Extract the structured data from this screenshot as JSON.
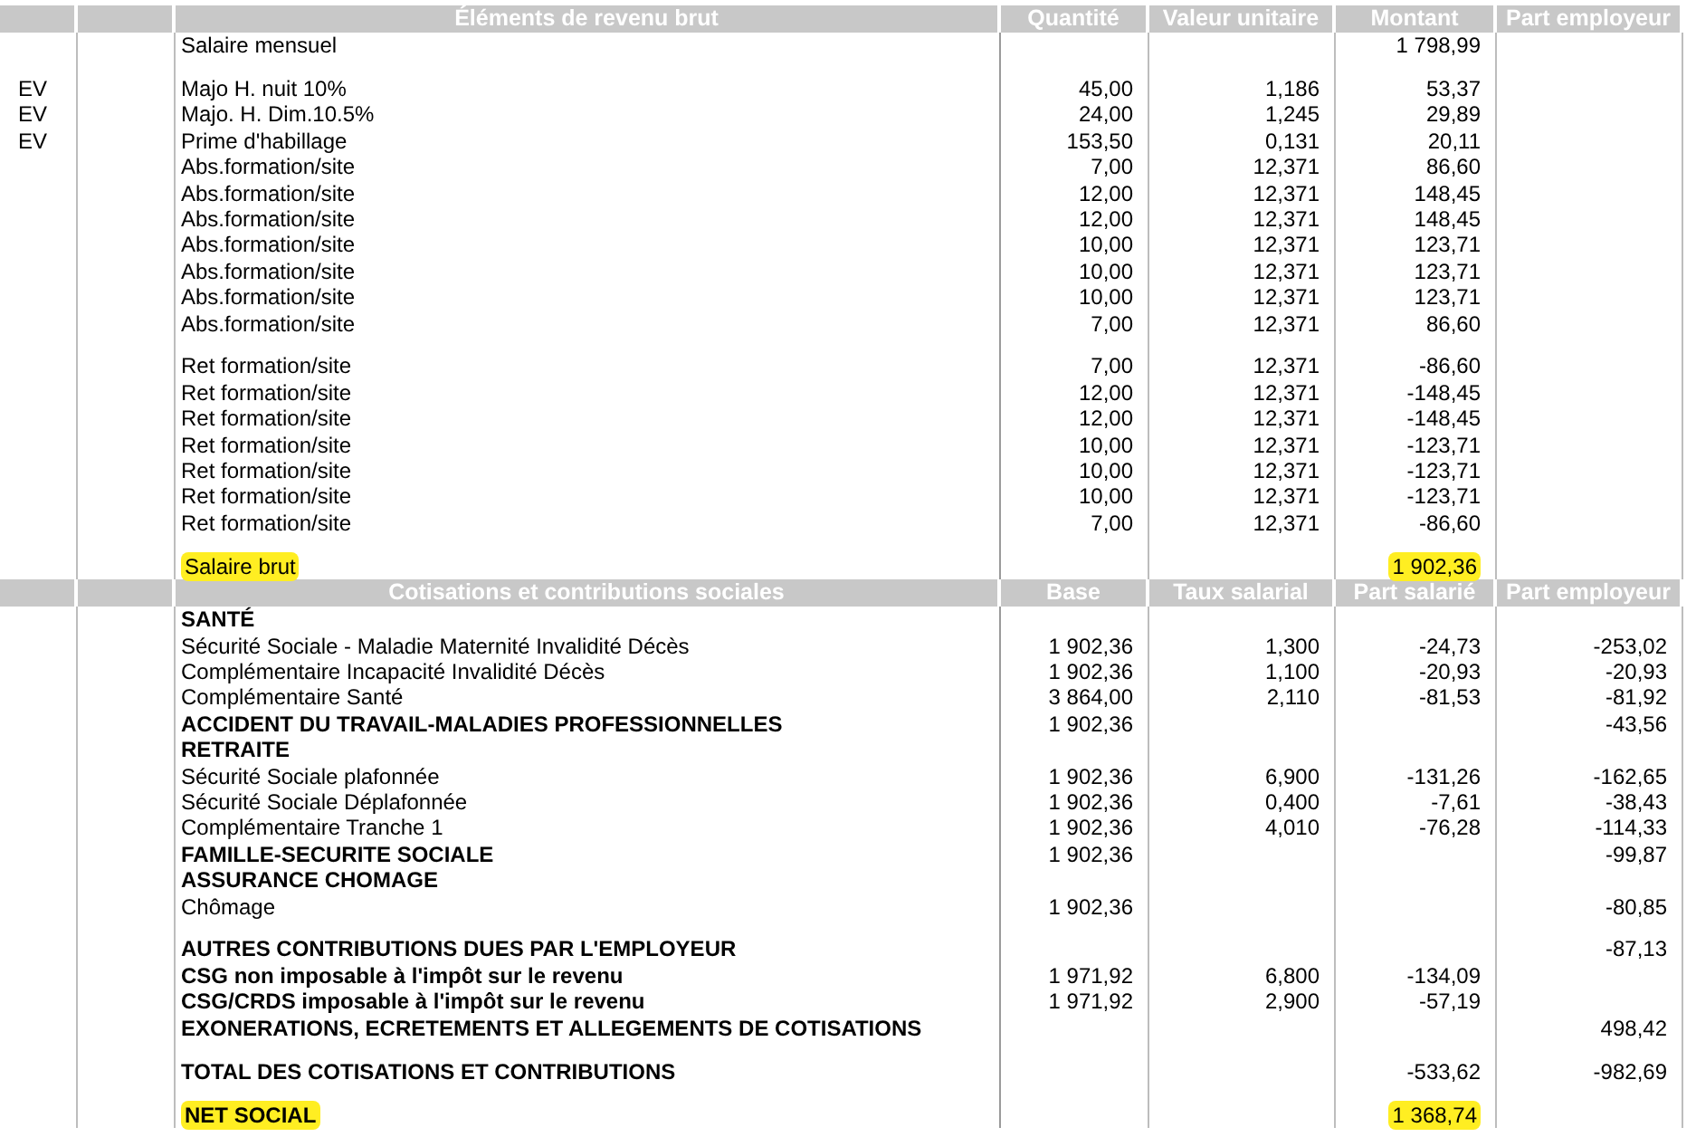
{
  "sections": [
    {
      "title": "Éléments de revenu brut",
      "columns": [
        "Quantité",
        "Valeur unitaire",
        "Montant",
        "Part employeur"
      ],
      "rows": [
        {
          "kind": "line",
          "space_before": false,
          "highlighted": false,
          "label": "Salaire mensuel",
          "amount": "1 798,99"
        },
        {
          "kind": "line",
          "space_before": true,
          "highlighted": false,
          "code": "EV",
          "label": "Majo H. nuit 10%",
          "quantity": "45,00",
          "unit_value": "1,186",
          "amount": "53,37"
        },
        {
          "kind": "line",
          "space_before": false,
          "highlighted": false,
          "code": "EV",
          "label": "Majo. H. Dim.10.5%",
          "quantity": "24,00",
          "unit_value": "1,245",
          "amount": "29,89"
        },
        {
          "kind": "line",
          "space_before": false,
          "highlighted": false,
          "code": "EV",
          "label": "Prime d'habillage",
          "quantity": "153,50",
          "unit_value": "0,131",
          "amount": "20,11"
        },
        {
          "kind": "line",
          "space_before": false,
          "highlighted": false,
          "label": "Abs.formation/site",
          "quantity": "7,00",
          "unit_value": "12,371",
          "amount": "86,60"
        },
        {
          "kind": "line",
          "space_before": false,
          "highlighted": false,
          "label": "Abs.formation/site",
          "quantity": "12,00",
          "unit_value": "12,371",
          "amount": "148,45"
        },
        {
          "kind": "line",
          "space_before": false,
          "highlighted": false,
          "label": "Abs.formation/site",
          "quantity": "12,00",
          "unit_value": "12,371",
          "amount": "148,45"
        },
        {
          "kind": "line",
          "space_before": false,
          "highlighted": false,
          "label": "Abs.formation/site",
          "quantity": "10,00",
          "unit_value": "12,371",
          "amount": "123,71"
        },
        {
          "kind": "line",
          "space_before": false,
          "highlighted": false,
          "label": "Abs.formation/site",
          "quantity": "10,00",
          "unit_value": "12,371",
          "amount": "123,71"
        },
        {
          "kind": "line",
          "space_before": false,
          "highlighted": false,
          "label": "Abs.formation/site",
          "quantity": "10,00",
          "unit_value": "12,371",
          "amount": "123,71"
        },
        {
          "kind": "line",
          "space_before": false,
          "highlighted": false,
          "label": "Abs.formation/site",
          "quantity": "7,00",
          "unit_value": "12,371",
          "amount": "86,60"
        },
        {
          "kind": "line",
          "space_before": true,
          "highlighted": false,
          "label": "Ret formation/site",
          "quantity": "7,00",
          "unit_value": "12,371",
          "amount": "-86,60"
        },
        {
          "kind": "line",
          "space_before": false,
          "highlighted": false,
          "label": "Ret formation/site",
          "quantity": "12,00",
          "unit_value": "12,371",
          "amount": "-148,45"
        },
        {
          "kind": "line",
          "space_before": false,
          "highlighted": false,
          "label": "Ret formation/site",
          "quantity": "12,00",
          "unit_value": "12,371",
          "amount": "-148,45"
        },
        {
          "kind": "line",
          "space_before": false,
          "highlighted": false,
          "label": "Ret formation/site",
          "quantity": "10,00",
          "unit_value": "12,371",
          "amount": "-123,71"
        },
        {
          "kind": "line",
          "space_before": false,
          "highlighted": false,
          "label": "Ret formation/site",
          "quantity": "10,00",
          "unit_value": "12,371",
          "amount": "-123,71"
        },
        {
          "kind": "line",
          "space_before": false,
          "highlighted": false,
          "label": "Ret formation/site",
          "quantity": "10,00",
          "unit_value": "12,371",
          "amount": "-123,71"
        },
        {
          "kind": "line",
          "space_before": false,
          "highlighted": false,
          "label": "Ret formation/site",
          "quantity": "7,00",
          "unit_value": "12,371",
          "amount": "-86,60"
        },
        {
          "kind": "line",
          "space_before": true,
          "highlighted": true,
          "label": "Salaire brut",
          "amount": "1 902,36"
        }
      ]
    },
    {
      "title": "Cotisations et contributions sociales",
      "columns": [
        "Base",
        "Taux salarial",
        "Part salarié",
        "Part employeur"
      ],
      "rows": [
        {
          "kind": "heading",
          "space_before": false,
          "highlighted": false,
          "label": "SANTÉ"
        },
        {
          "kind": "line",
          "space_before": false,
          "highlighted": false,
          "label": "Sécurité Sociale - Maladie Maternité Invalidité Décès",
          "base": "1 902,36",
          "employee_rate": "1,300",
          "employee_part": "-24,73",
          "employer_part": "-253,02"
        },
        {
          "kind": "line",
          "space_before": false,
          "highlighted": false,
          "label": "Complémentaire Incapacité Invalidité Décès",
          "base": "1 902,36",
          "employee_rate": "1,100",
          "employee_part": "-20,93",
          "employer_part": "-20,93"
        },
        {
          "kind": "line",
          "space_before": false,
          "highlighted": false,
          "label": "Complémentaire Santé",
          "base": "3 864,00",
          "employee_rate": "2,110",
          "employee_part": "-81,53",
          "employer_part": "-81,92"
        },
        {
          "kind": "heading",
          "space_before": false,
          "highlighted": false,
          "label": "ACCIDENT DU TRAVAIL-MALADIES PROFESSIONNELLES",
          "base": "1 902,36",
          "employer_part": "-43,56"
        },
        {
          "kind": "heading",
          "space_before": false,
          "highlighted": false,
          "label": "RETRAITE"
        },
        {
          "kind": "line",
          "space_before": false,
          "highlighted": false,
          "label": "Sécurité Sociale plafonnée",
          "base": "1 902,36",
          "employee_rate": "6,900",
          "employee_part": "-131,26",
          "employer_part": "-162,65"
        },
        {
          "kind": "line",
          "space_before": false,
          "highlighted": false,
          "label": "Sécurité Sociale Déplafonnée",
          "base": "1 902,36",
          "employee_rate": "0,400",
          "employee_part": "-7,61",
          "employer_part": "-38,43"
        },
        {
          "kind": "line",
          "space_before": false,
          "highlighted": false,
          "label": "Complémentaire Tranche 1",
          "base": "1 902,36",
          "employee_rate": "4,010",
          "employee_part": "-76,28",
          "employer_part": "-114,33"
        },
        {
          "kind": "heading",
          "space_before": false,
          "highlighted": false,
          "label": "FAMILLE-SECURITE SOCIALE",
          "base": "1 902,36",
          "employer_part": "-99,87"
        },
        {
          "kind": "heading",
          "space_before": false,
          "highlighted": false,
          "label": "ASSURANCE CHOMAGE"
        },
        {
          "kind": "line",
          "space_before": false,
          "highlighted": false,
          "label": "Chômage",
          "base": "1 902,36",
          "employer_part": "-80,85"
        },
        {
          "kind": "heading",
          "space_before": true,
          "highlighted": false,
          "label": "AUTRES CONTRIBUTIONS DUES PAR L'EMPLOYEUR",
          "employer_part": "-87,13"
        },
        {
          "kind": "heading",
          "space_before": false,
          "highlighted": false,
          "label": "CSG non imposable à l'impôt sur le revenu",
          "base": "1 971,92",
          "employee_rate": "6,800",
          "employee_part": "-134,09"
        },
        {
          "kind": "heading",
          "space_before": false,
          "highlighted": false,
          "label": "CSG/CRDS imposable à l'impôt sur le revenu",
          "base": "1 971,92",
          "employee_rate": "2,900",
          "employee_part": "-57,19"
        },
        {
          "kind": "heading",
          "space_before": false,
          "highlighted": false,
          "label": "EXONERATIONS, ECRETEMENTS ET ALLEGEMENTS DE COTISATIONS",
          "employer_part": "498,42"
        },
        {
          "kind": "heading",
          "space_before": true,
          "highlighted": false,
          "label": "TOTAL DES COTISATIONS ET CONTRIBUTIONS",
          "employee_part": "-533,62",
          "employer_part": "-982,69"
        },
        {
          "kind": "heading",
          "space_before": true,
          "highlighted": true,
          "label": "NET SOCIAL",
          "employee_part": "1 368,74"
        }
      ]
    }
  ]
}
